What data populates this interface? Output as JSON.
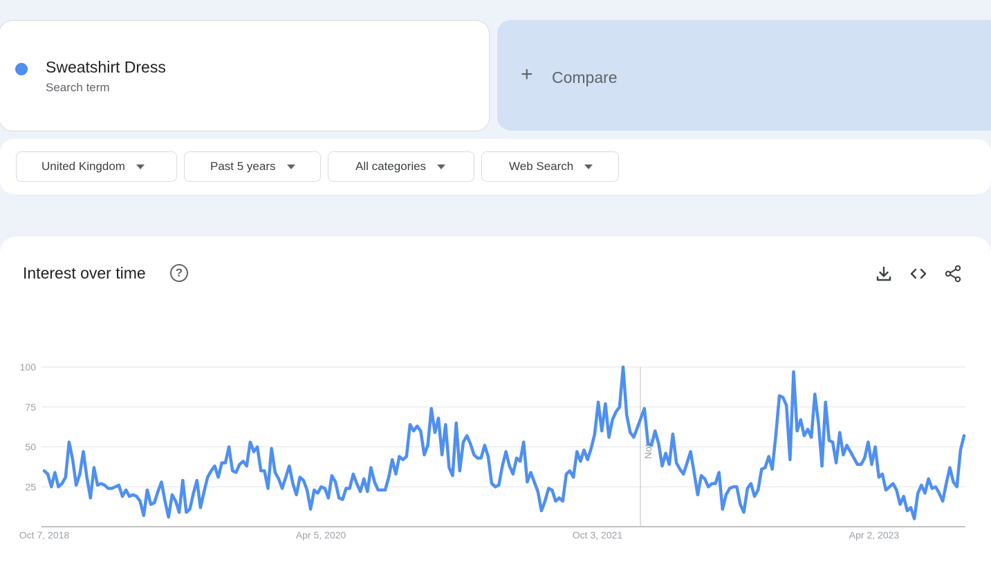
{
  "search_term": {
    "label": "Sweatshirt Dress",
    "sublabel": "Search term",
    "color": "#4f8ff0"
  },
  "compare": {
    "icon": "plus-icon",
    "label": "Compare"
  },
  "filters": [
    {
      "label": "United Kingdom",
      "icon": "caret-down-icon"
    },
    {
      "label": "Past 5 years",
      "icon": "caret-down-icon"
    },
    {
      "label": "All categories",
      "icon": "caret-down-icon"
    },
    {
      "label": "Web Search",
      "icon": "caret-down-icon"
    }
  ],
  "interest_card": {
    "title": "Interest over time",
    "help_icon": "help-icon",
    "tools": [
      "download-icon",
      "embed-code-icon",
      "share-icon"
    ]
  },
  "chart_data": {
    "type": "line",
    "series": [
      {
        "name": "Sweatshirt Dress",
        "color": "#4f8ff0",
        "values": [
          35,
          33,
          25,
          34,
          25,
          27,
          31,
          53,
          42,
          26,
          33,
          47,
          31,
          18,
          37,
          26,
          27,
          26,
          24,
          24,
          25,
          26,
          19,
          23,
          19,
          20,
          19,
          16,
          7,
          23,
          14,
          15,
          22,
          28,
          16,
          6,
          20,
          16,
          9,
          29,
          9,
          11,
          21,
          29,
          12,
          22,
          31,
          35,
          38,
          31,
          40,
          40,
          50,
          35,
          34,
          39,
          41,
          38,
          53,
          47,
          50,
          35,
          35,
          24,
          49,
          34,
          30,
          24,
          31,
          38,
          27,
          20,
          31,
          29,
          23,
          11,
          23,
          21,
          25,
          24,
          18,
          32,
          28,
          18,
          17,
          24,
          24,
          33,
          27,
          22,
          30,
          22,
          37,
          28,
          23,
          23,
          23,
          31,
          42,
          33,
          44,
          42,
          44,
          64,
          60,
          63,
          60,
          45,
          51,
          74,
          59,
          68,
          45,
          64,
          37,
          32,
          65,
          35,
          53,
          57,
          52,
          45,
          43,
          43,
          51,
          44,
          27,
          25,
          26,
          38,
          47,
          38,
          33,
          43,
          41,
          53,
          28,
          34,
          28,
          22,
          10,
          16,
          24,
          23,
          16,
          18,
          16,
          33,
          35,
          31,
          47,
          41,
          48,
          42,
          49,
          58,
          78,
          60,
          77,
          56,
          67,
          72,
          75,
          100,
          70,
          59,
          56,
          62,
          68,
          74,
          52,
          51,
          60,
          52,
          38,
          46,
          39,
          58,
          40,
          36,
          33,
          40,
          47,
          34,
          20,
          32,
          30,
          25,
          27,
          27,
          34,
          11,
          20,
          24,
          25,
          25,
          14,
          9,
          24,
          27,
          19,
          23,
          36,
          37,
          44,
          36,
          57,
          82,
          81,
          76,
          42,
          97,
          60,
          67,
          57,
          61,
          56,
          83,
          65,
          38,
          78,
          54,
          53,
          40,
          59,
          45,
          51,
          47,
          43,
          39,
          39,
          43,
          53,
          39,
          50,
          31,
          33,
          23,
          25,
          27,
          23,
          14,
          19,
          10,
          12,
          5,
          21,
          26,
          21,
          30,
          24,
          25,
          21,
          16,
          27,
          37,
          28,
          25,
          48,
          57
        ]
      }
    ],
    "x_tick_labels": [
      "Oct 7, 2018",
      "Apr 5, 2020",
      "Oct 3, 2021",
      "Apr 2, 2023"
    ],
    "y_ticks": [
      25,
      50,
      75,
      100
    ],
    "ylim": [
      0,
      100
    ],
    "annotation": "Note",
    "grid": true
  }
}
